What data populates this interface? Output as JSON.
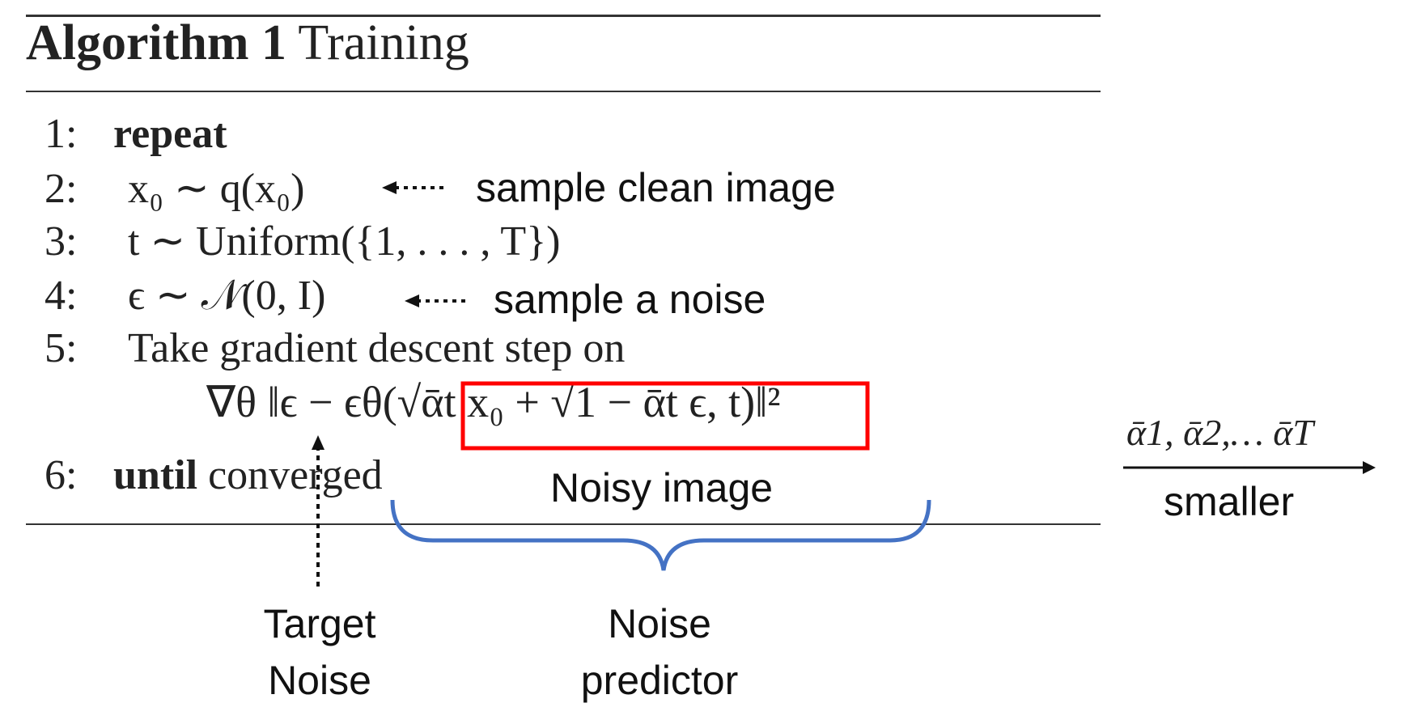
{
  "algorithm": {
    "title_bold": "Algorithm 1",
    "title_rest": "Training",
    "lines": [
      {
        "num": "1:",
        "keyword": "repeat",
        "rest": ""
      },
      {
        "num": "2:",
        "text": "x₀ ∼ q(x₀)"
      },
      {
        "num": "3:",
        "text": "t ∼ Uniform({1, . . . , T})"
      },
      {
        "num": "4:",
        "text": "ϵ ∼ 𝒩(0, I)"
      },
      {
        "num": "5:",
        "text": "Take gradient descent step on"
      },
      {
        "num": "",
        "text": "∇θ ‖ϵ − ϵθ(√ᾱt x₀ + √1 − ᾱt ϵ, t)‖²"
      },
      {
        "num": "6:",
        "keyword": "until",
        "rest": "converged"
      }
    ]
  },
  "annotations": {
    "sample_clean_image": "sample clean image",
    "sample_a_noise": "sample a noise",
    "noisy_image": "Noisy image",
    "target_noise_line1": "Target",
    "target_noise_line2": "Noise",
    "noise_predictor_line1": "Noise",
    "noise_predictor_line2": "predictor"
  },
  "schedule": {
    "alphas": "ᾱ1, ᾱ2,… ᾱT",
    "label": "smaller"
  },
  "colors": {
    "highlight_box": "#ff0000",
    "brace": "#4472c4",
    "text": "#222222"
  }
}
